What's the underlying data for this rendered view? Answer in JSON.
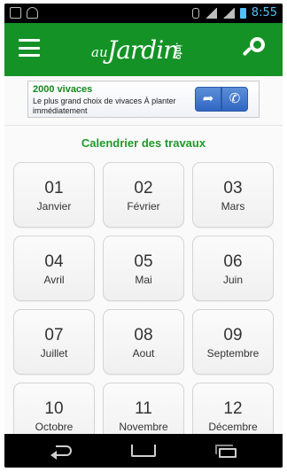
{
  "status_bar": {
    "time": "8:55",
    "icons": [
      "image-icon",
      "android-icon",
      "bluetooth-icon",
      "wifi-icon",
      "signal-icon",
      "battery-icon"
    ]
  },
  "header": {
    "brand_prefix": "au",
    "brand_name": "Jardin",
    "brand_suffix": ".info",
    "color": "#149226"
  },
  "ad": {
    "title": "2000 vivaces",
    "text": "Le plus grand choix de vivaces À planter immédiatement"
  },
  "calendar": {
    "title": "Calendrier des travaux",
    "months": [
      {
        "num": "01",
        "name": "Janvier"
      },
      {
        "num": "02",
        "name": "Février"
      },
      {
        "num": "03",
        "name": "Mars"
      },
      {
        "num": "04",
        "name": "Avril"
      },
      {
        "num": "05",
        "name": "Mai"
      },
      {
        "num": "06",
        "name": "Juin"
      },
      {
        "num": "07",
        "name": "Juillet"
      },
      {
        "num": "08",
        "name": "Aout"
      },
      {
        "num": "09",
        "name": "Septembre"
      },
      {
        "num": "10",
        "name": "Octobre"
      },
      {
        "num": "11",
        "name": "Novembre"
      },
      {
        "num": "12",
        "name": "Décembre"
      }
    ]
  },
  "colors": {
    "accent": "#149226",
    "section_title": "#1f9a2a",
    "status_time": "#4fc3f7"
  }
}
